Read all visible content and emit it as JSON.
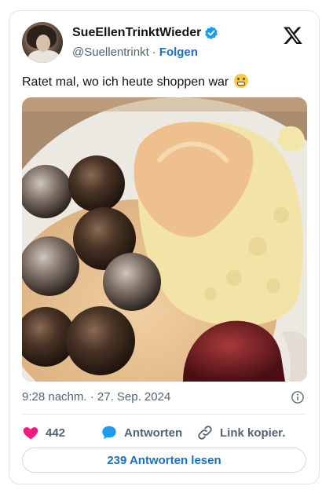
{
  "author": {
    "display_name": "SueEllenTrinktWieder",
    "handle": "@Suellentrinkt",
    "separator": "·",
    "follow_label": "Folgen"
  },
  "tweet": {
    "text": "Ratet mal, wo ich heute shoppen war",
    "emoji_name": "grimacing-face-emoji",
    "image_alt": "Köttbullar mit Kartoffelpüree, Rahmsauce und Preiselbeeren"
  },
  "meta": {
    "timestamp": "9:28 nachm. · 27. Sep. 2024"
  },
  "actions": {
    "like_count": "442",
    "reply_label": "Antworten",
    "copy_link_label": "Link kopier."
  },
  "read_replies_label": "239 Antworten lesen",
  "colors": {
    "accent": "#1d6fc1",
    "like": "#f91880",
    "verified": "#1d9bf0"
  }
}
